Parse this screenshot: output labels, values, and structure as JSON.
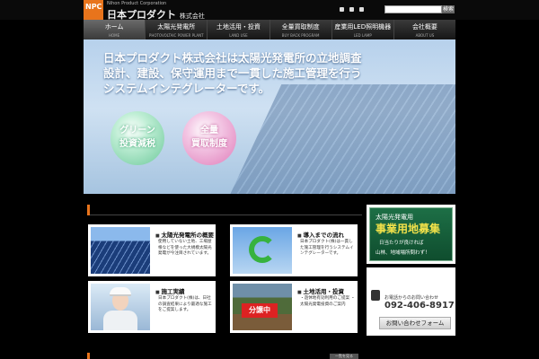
{
  "header": {
    "logo_mark": "NPC",
    "logo_sub": "Nihon Product Corporation",
    "logo_name": "日本プロダクト",
    "logo_suffix": "株式会社",
    "search_placeholder": "",
    "search_button": "検索"
  },
  "nav": [
    {
      "jp": "ホーム",
      "en": "HOME"
    },
    {
      "jp": "太陽光発電所",
      "en": "PHOTOVOLTAIC POWER PLANT"
    },
    {
      "jp": "土地活用・投資",
      "en": "LAND USE"
    },
    {
      "jp": "全量買取制度",
      "en": "BUY BACK PROGRAM"
    },
    {
      "jp": "産業用LED照明機器",
      "en": "LED LAMP"
    },
    {
      "jp": "会社概要",
      "en": "ABOUT US"
    }
  ],
  "hero": {
    "line1": "日本プロダクト株式会社は太陽光発電所の立地調査",
    "line2": "設計、建設、保守運用まで一貫した施工管理を行う",
    "line3": "システムインテグレーターです。",
    "bubble1_line1": "グリーン",
    "bubble1_line2": "投資減税",
    "bubble2_line1": "全量",
    "bubble2_line2": "買取制度"
  },
  "cards": [
    {
      "title": "太陽光発電所の概要",
      "desc": "使用していない土地、工場屋根などを使った大規模太陽光発電が今注目されています。"
    },
    {
      "title": "導入までの流れ",
      "desc": "日本プロダクト(株)は一貫した施工管理を行うシステムインテグレーターです。"
    },
    {
      "title": "施工実績",
      "desc": "日本プロダクト(株)は、日社の調査結果により最適な施工をご提案します。"
    },
    {
      "title": "土地活用・投資",
      "desc": "・遊休地有効利用のご提案 ・太陽光発電投資のご案内"
    }
  ],
  "land_sign": "分譲中",
  "banner": {
    "line1": "太陽光発電用",
    "line2": "事業用地募集",
    "line3": "日当たりが良ければ",
    "line4": "山林、地域場所問わず！"
  },
  "contact": {
    "label": "お電話からのお問い合わせ",
    "tel": "092-406-8917",
    "button": "お問い合わせフォーム"
  },
  "list_button": "一覧を見る"
}
